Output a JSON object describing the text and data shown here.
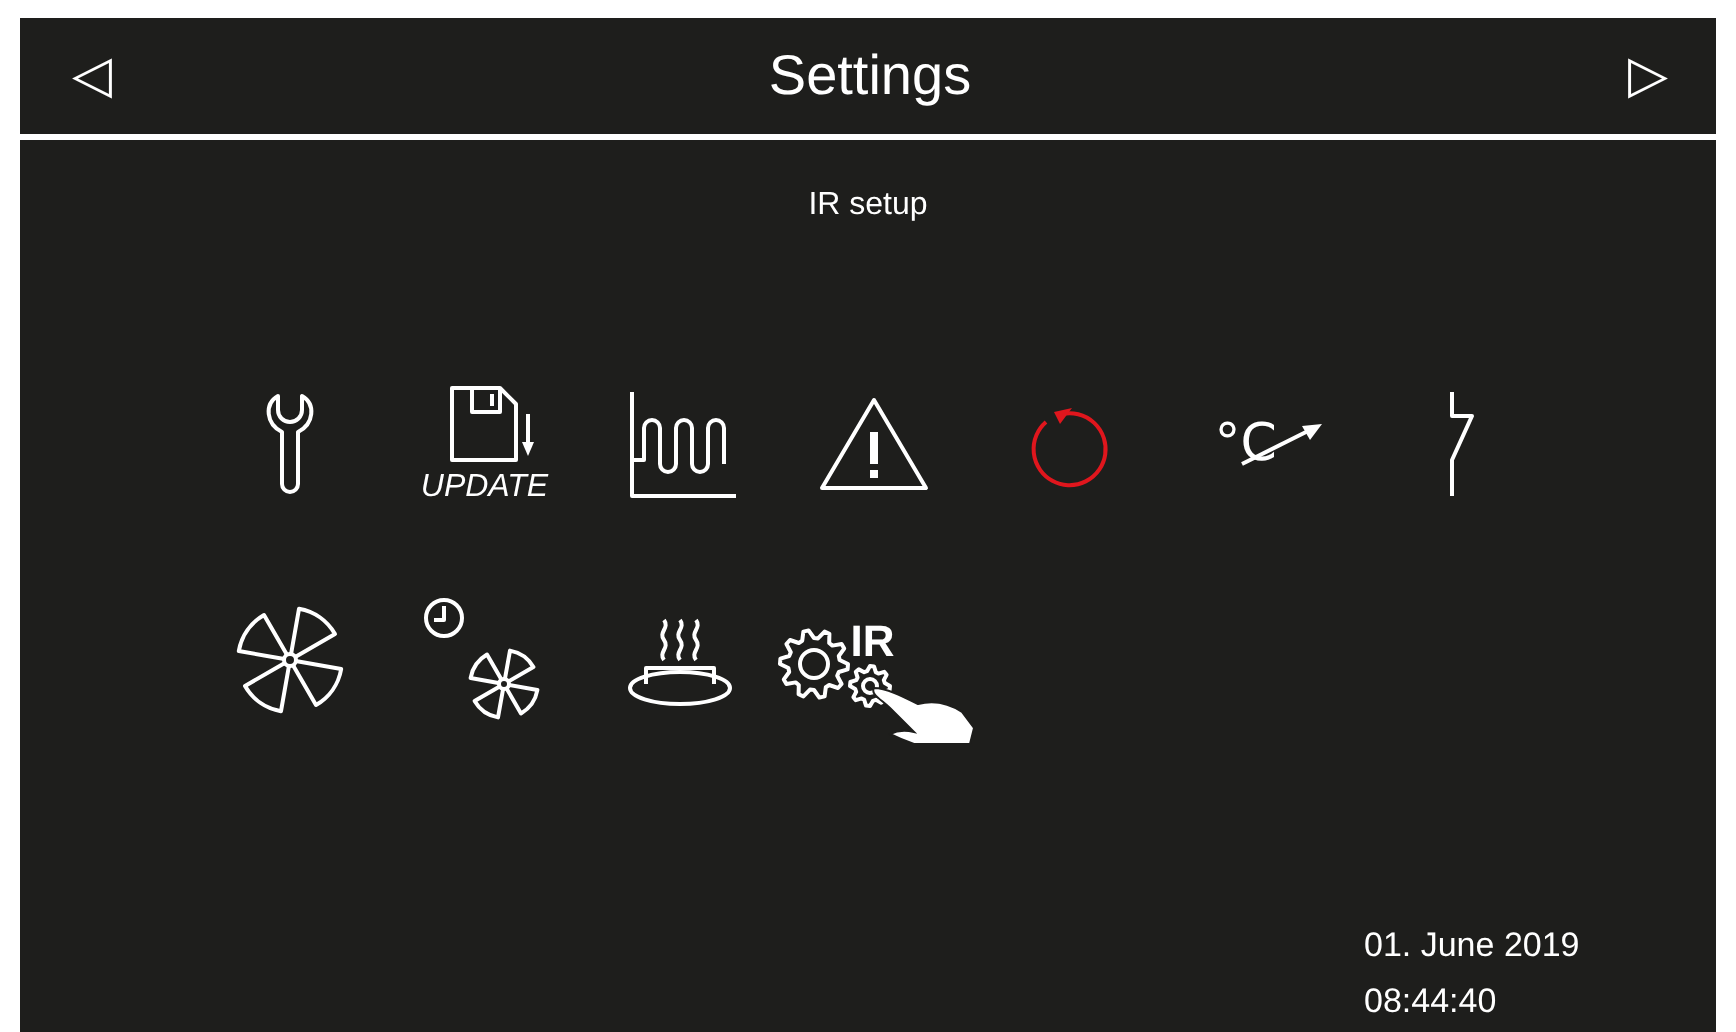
{
  "header": {
    "back_arrow": "◁",
    "title": "Settings",
    "forward_arrow": "▷"
  },
  "subtitle": "IR setup",
  "tile_rows": [
    [
      {
        "kind": "wrench"
      },
      {
        "kind": "update",
        "label": "UPDATE"
      },
      {
        "kind": "heating-curve"
      },
      {
        "kind": "warning"
      },
      {
        "kind": "restart"
      },
      {
        "kind": "temperature-offset",
        "label": "°C"
      },
      {
        "kind": "switch-contact"
      }
    ],
    [
      {
        "kind": "fan"
      },
      {
        "kind": "fan-timer"
      },
      {
        "kind": "heated-plate"
      },
      {
        "kind": "ir-setup",
        "label": "IR"
      }
    ]
  ],
  "date": "01. June 2019",
  "time": "08:44:40"
}
